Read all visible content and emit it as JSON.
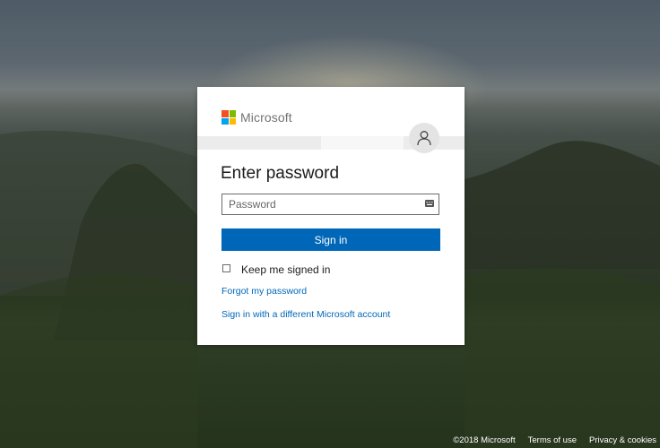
{
  "brand": {
    "name": "Microsoft",
    "logo_colors": [
      "#f25022",
      "#7fba00",
      "#00a4ef",
      "#ffb900"
    ]
  },
  "identity": {
    "email": "",
    "avatar_icon": "user-icon"
  },
  "form": {
    "heading": "Enter password",
    "password_placeholder": "Password",
    "password_value": "",
    "keyboard_icon": "keyboard-icon",
    "signin_label": "Sign in",
    "keep_signed_in_label": "Keep me signed in",
    "keep_signed_in_checked": false,
    "forgot_password_label": "Forgot my password",
    "different_account_label": "Sign in with a different Microsoft account"
  },
  "colors": {
    "accent": "#0067b8",
    "card_bg": "#ffffff",
    "text": "#1b1b1b"
  },
  "footer": {
    "copyright": "©2018 Microsoft",
    "terms": "Terms of use",
    "privacy": "Privacy & cookies"
  }
}
